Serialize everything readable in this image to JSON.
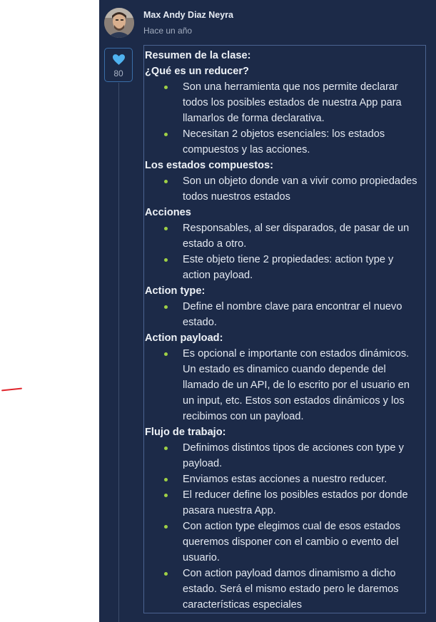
{
  "comment": {
    "author": "Max Andy Diaz Neyra",
    "time": "Hace un año",
    "likes": "80"
  },
  "sections": [
    {
      "heading": "Resumen de la clase:",
      "items": []
    },
    {
      "heading": "¿Qué es un reducer?",
      "items": [
        "Son una herramienta que nos permite declarar todos los posibles estados de nuestra App para llamarlos de forma declarativa.",
        "Necesitan 2 objetos esenciales: los estados compuestos y las acciones."
      ]
    },
    {
      "heading": "Los estados compuestos:",
      "items": [
        "Son un objeto donde van a vivir como propiedades todos nuestros estados"
      ]
    },
    {
      "heading": "Acciones",
      "items": [
        "Responsables, al ser disparados, de pasar de un estado a otro.",
        "Este objeto tiene 2 propiedades: action type y action payload."
      ]
    },
    {
      "heading": "Action type:",
      "items": [
        "Define el nombre clave para encontrar el nuevo estado."
      ]
    },
    {
      "heading": "Action payload:",
      "items": [
        "Es opcional e importante con estados dinámicos. Un estado es dinamico cuando depende del llamado de un API, de lo escrito por el usuario en un input, etc. Estos son estados dinámicos y los recibimos con un payload."
      ]
    },
    {
      "heading": "Flujo de trabajo:",
      "items": [
        "Definimos distintos tipos de acciones con type y payload.",
        "Enviamos estas acciones a nuestro reducer.",
        "El reducer define los posibles estados por donde pasara nuestra App.",
        "Con action type elegimos cual de esos estados queremos disponer con el cambio o evento del usuario.",
        "Con action payload damos dinamismo a dicho estado. Será el mismo estado pero le daremos características especiales"
      ]
    }
  ],
  "colors": {
    "panel_bg": "#1c2a48",
    "bullet": "#9fd046",
    "heart": "#4fb2f0",
    "border": "#4b6391"
  },
  "icons": {
    "like": "heart-icon",
    "avatar": "user-photo"
  }
}
